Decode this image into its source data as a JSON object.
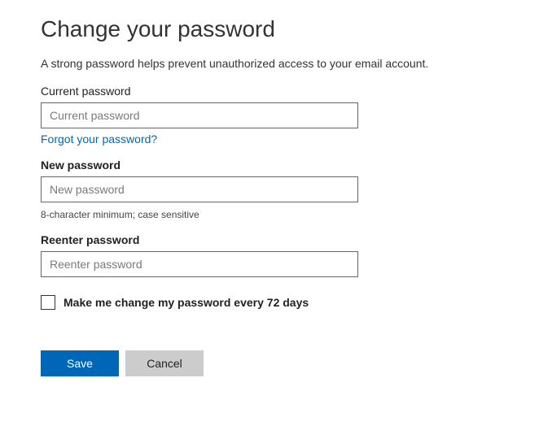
{
  "title": "Change your password",
  "subtitle": "A strong password helps prevent unauthorized access to your email account.",
  "current": {
    "label": "Current password",
    "placeholder": "Current password",
    "value": ""
  },
  "forgot_link": "Forgot your password?",
  "new": {
    "label": "New password",
    "placeholder": "New password",
    "value": ""
  },
  "hint": "8-character minimum; case sensitive",
  "reenter": {
    "label": "Reenter password",
    "placeholder": "Reenter password",
    "value": ""
  },
  "checkbox_label": "Make me change my password every 72 days",
  "buttons": {
    "save": "Save",
    "cancel": "Cancel"
  }
}
